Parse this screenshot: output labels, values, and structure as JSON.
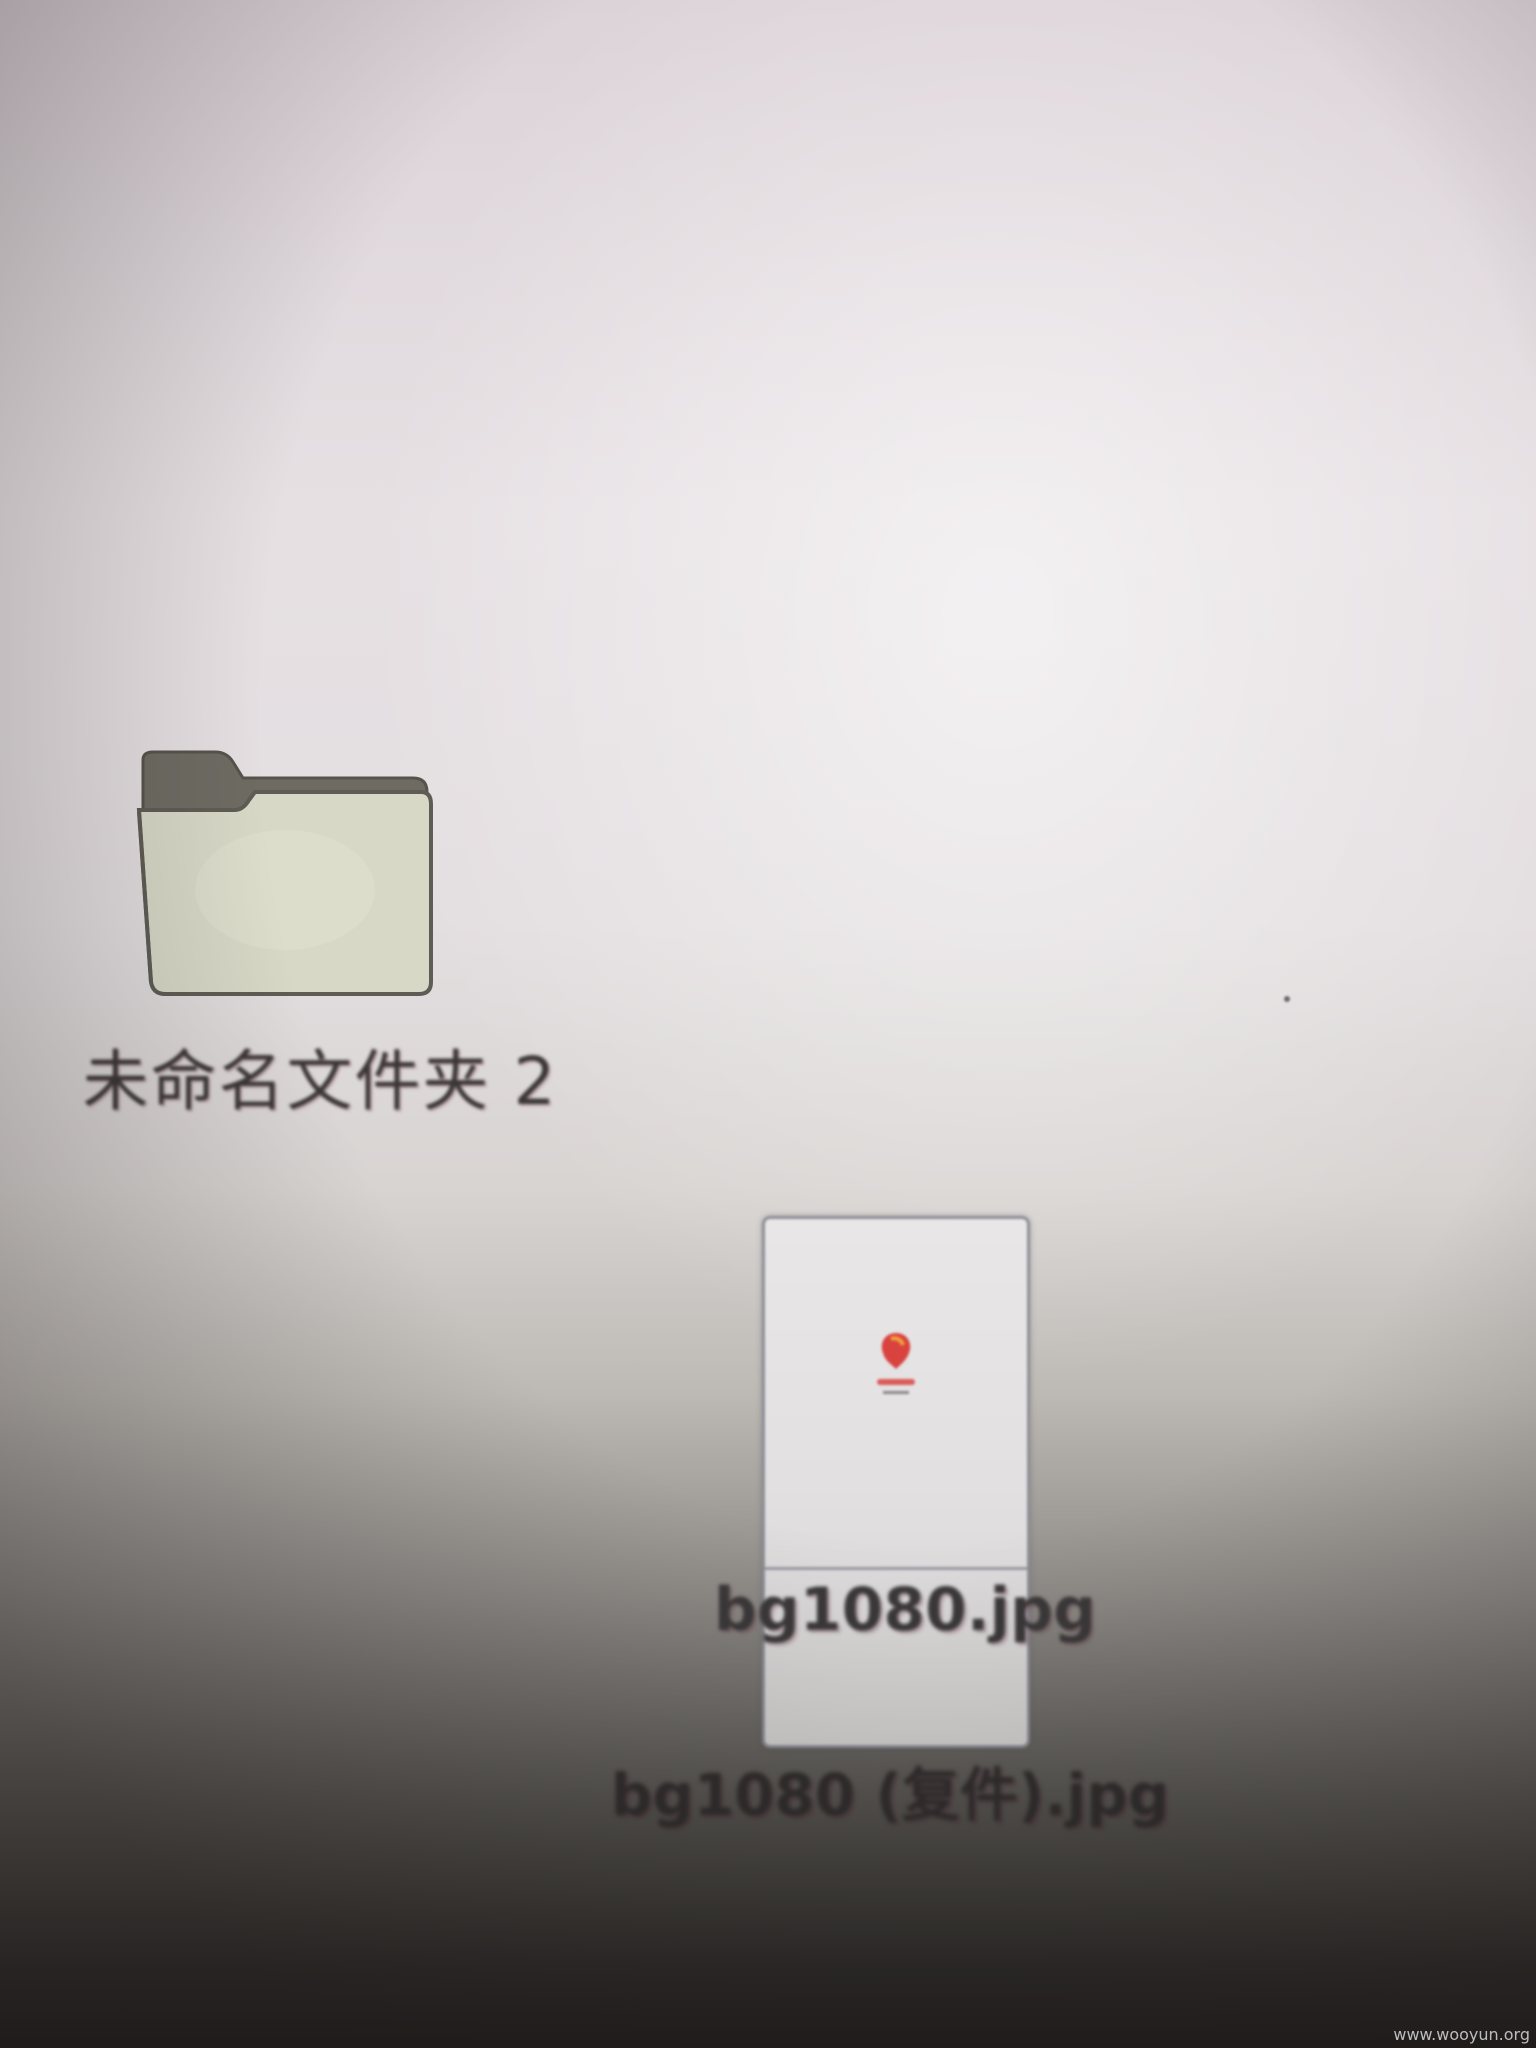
{
  "desktop": {
    "items": [
      {
        "type": "folder",
        "label": "未命名文件夹 2",
        "icon": "folder-icon"
      },
      {
        "type": "image-file",
        "label": "bg1080.jpg",
        "icon": "image-thumbnail-icon"
      },
      {
        "type": "image-file",
        "label": "bg1080 (复件).jpg",
        "icon": "image-thumbnail-icon"
      }
    ]
  },
  "watermark": "www.wooyun.org",
  "colors": {
    "folder_body": "#d8d8c7",
    "folder_tab": "#6d6b62",
    "label_text": "#3a3637",
    "logo_accent": "#d9433f"
  }
}
